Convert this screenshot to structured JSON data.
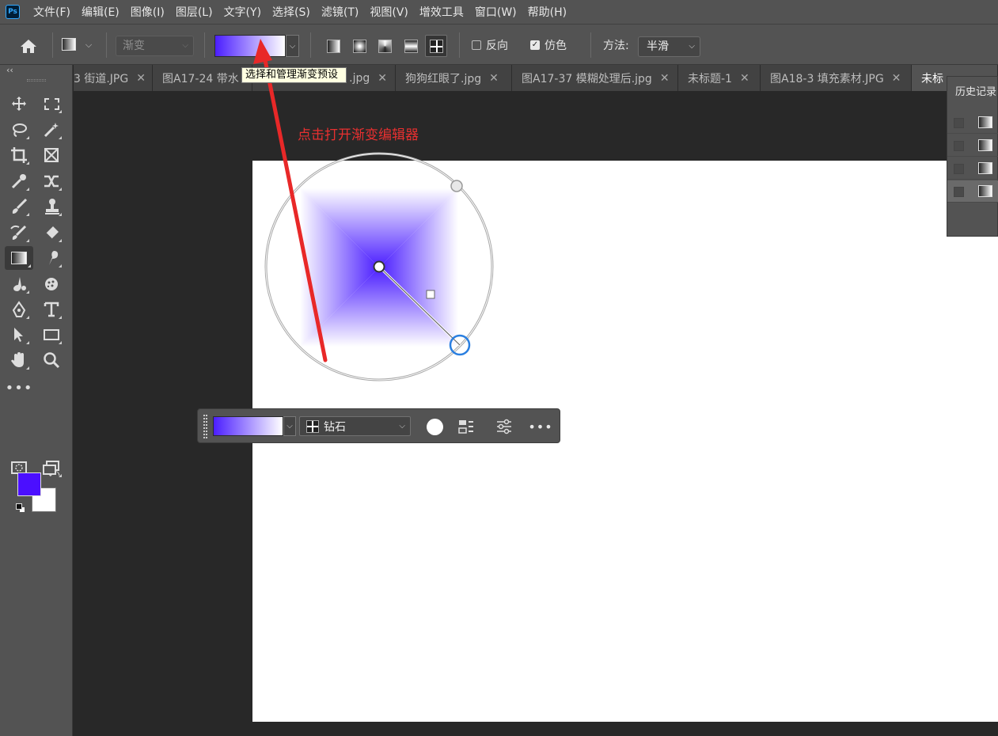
{
  "app": {
    "logo": "Ps"
  },
  "menu": [
    "文件(F)",
    "编辑(E)",
    "图像(I)",
    "图层(L)",
    "文字(Y)",
    "选择(S)",
    "滤镜(T)",
    "视图(V)",
    "增效工具",
    "窗口(W)",
    "帮助(H)"
  ],
  "options": {
    "preset_placeholder": "渐变",
    "reverse_label": "反向",
    "reverse_checked": false,
    "dither_label": "仿色",
    "dither_checked": true,
    "method_label": "方法:",
    "method_value": "半滑",
    "gradient_start": "#4b1eff",
    "gradient_end": "#ffffff"
  },
  "tabs": [
    {
      "label": "3 街道.JPG",
      "active": false
    },
    {
      "label": "图A17-24 带水",
      "active": false
    },
    {
      "label": ".jpg",
      "active": false
    },
    {
      "label": "狗狗红眼了.jpg",
      "active": false
    },
    {
      "label": "图A17-37 模糊处理后.jpg",
      "active": false
    },
    {
      "label": "未标题-1",
      "active": false
    },
    {
      "label": "图A18-3 填充素材.JPG",
      "active": false
    },
    {
      "label": "未标",
      "active": true
    }
  ],
  "tooltip": "选择和管理渐变预设",
  "annotation": "点击打开渐变编辑器",
  "history": {
    "title": "历史记录",
    "rows": 4
  },
  "colors": {
    "foreground": "#4b0fff",
    "background": "#ffffff",
    "annotation": "#e82828"
  },
  "taskbar": {
    "type_label": "钻石"
  }
}
